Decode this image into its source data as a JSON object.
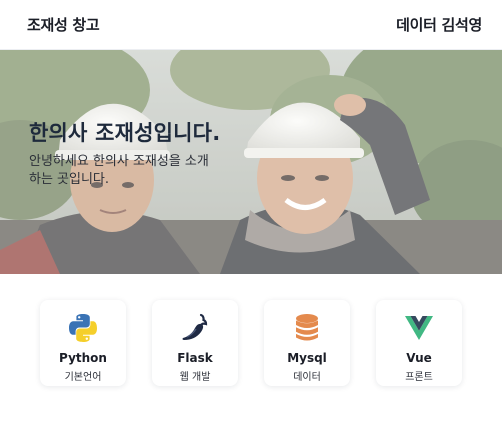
{
  "header": {
    "brand": "조재성 창고",
    "nav_link": "데이터 김석영"
  },
  "hero": {
    "title": "한의사 조재성입니다.",
    "description": "안녕하세요 한의사 조재성을 소개하는 곳입니다."
  },
  "cards": [
    {
      "title": "Python",
      "subtitle": "기본언어",
      "icon": "python-icon"
    },
    {
      "title": "Flask",
      "subtitle": "웹 개발",
      "icon": "flask-pepper-icon"
    },
    {
      "title": "Mysql",
      "subtitle": "데이터",
      "icon": "database-icon"
    },
    {
      "title": "Vue",
      "subtitle": "프론트",
      "icon": "vue-icon"
    }
  ],
  "colors": {
    "python_blue": "#3a73b5",
    "python_yellow": "#f5cf2b",
    "flask_dark": "#1f2a44",
    "mysql_orange": "#e48a4d",
    "vue_green": "#41b883",
    "vue_dark": "#35495e"
  }
}
